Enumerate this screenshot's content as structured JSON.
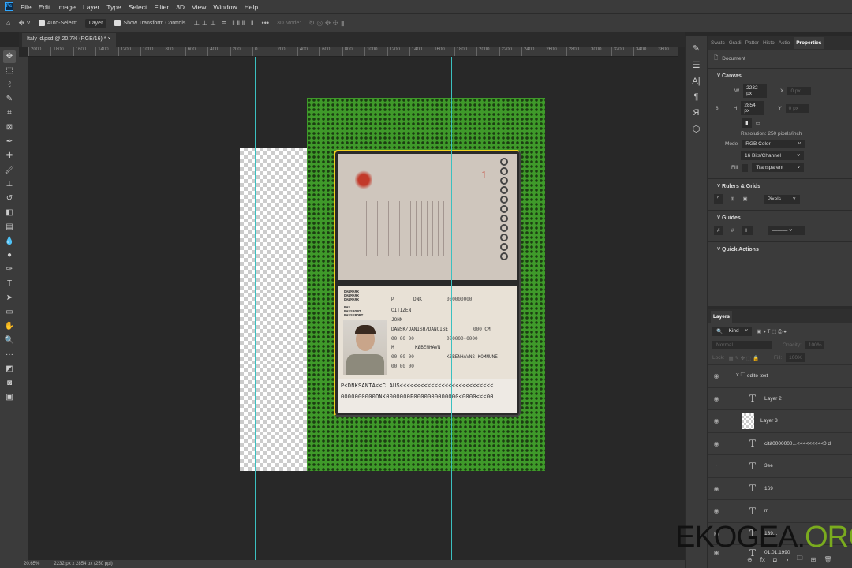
{
  "menu": [
    "File",
    "Edit",
    "Image",
    "Layer",
    "Type",
    "Select",
    "Filter",
    "3D",
    "View",
    "Window",
    "Help"
  ],
  "options": {
    "auto_select": "Auto-Select:",
    "auto_select_target": "Layer",
    "show_transform": "Show Transform Controls",
    "mode_3d": "3D Mode:"
  },
  "document_tab": "Italy id.psd @ 20.7% (RGB/16) *",
  "ruler_labels": [
    "2000",
    "1800",
    "1600",
    "1400",
    "1200",
    "1000",
    "800",
    "600",
    "400",
    "200",
    "0",
    "200",
    "400",
    "600",
    "800",
    "1000",
    "1200",
    "1400",
    "1600",
    "1800",
    "2000",
    "2200",
    "2400",
    "2600",
    "2800",
    "3000",
    "3200",
    "3400",
    "3600"
  ],
  "status": {
    "zoom": "20.65%",
    "doc_info": "2232 px x 2854 px (250 ppi)"
  },
  "passport": {
    "labels1": [
      "DANMARK",
      "DANMARK",
      "DANMARK"
    ],
    "labels2": [
      "PAS",
      "PASSPORT",
      "PASSEPORT"
    ],
    "type": "P",
    "code": "DNK",
    "number": "000000000",
    "surname": "CITIZEN",
    "given": "JOHN",
    "nationality": "DANSK/DANISH/DANOISE",
    "height": "000 CM",
    "dob": "00 00 00",
    "personal_no": "000000-0000",
    "sex": "M",
    "pob": "KØBENHAVN",
    "issue": "00 00 00",
    "authority": "KØBENHAVNS KOMMUNE",
    "expiry": "00 00 00",
    "page_number": "1",
    "mrz1": "P<DNKSANTA<<CLAUS<<<<<<<<<<<<<<<<<<<<<<<<<<<",
    "mrz2": "0000000000DNK0000000F0000000000000<0000<<<00"
  },
  "properties": {
    "tabs": [
      "Swatc",
      "Gradi",
      "Patter",
      "Histo",
      "Actio",
      "Properties"
    ],
    "doc_label": "Document",
    "canvas_title": "Canvas",
    "w_label": "W",
    "w": "2232 px",
    "h_label": "H",
    "h": "2854 px",
    "x_label": "X",
    "y_label": "Y",
    "xy_placeholder": "0 px",
    "resolution": "Resolution: 250 pixels/inch",
    "mode_label": "Mode",
    "mode": "RGB Color",
    "depth": "16 Bits/Channel",
    "fill_label": "Fill",
    "fill": "Transparent",
    "rulers_title": "Rulers & Grids",
    "units": "Pixels",
    "guides_title": "Guides",
    "quick_actions": "Quick Actions"
  },
  "layers": {
    "tab": "Layers",
    "filter": "Kind",
    "blend": "Normal",
    "opacity_label": "Opacity:",
    "opacity": "100%",
    "lock_label": "Lock:",
    "fill_label": "Fill:",
    "fill": "100%",
    "items": [
      {
        "name": "edite text",
        "kind": "group"
      },
      {
        "name": "Layer 2",
        "kind": "text"
      },
      {
        "name": "Layer 3",
        "kind": "pixel"
      },
      {
        "name": "cità0000000...<<<<<<<<<0 d",
        "kind": "text"
      },
      {
        "name": "3ee",
        "kind": "text"
      },
      {
        "name": "169",
        "kind": "text"
      },
      {
        "name": "m",
        "kind": "text"
      },
      {
        "name": "139...",
        "kind": "text"
      },
      {
        "name": "01.01.1990",
        "kind": "text"
      }
    ]
  },
  "watermark": {
    "part1": "EKOGEA.",
    "part2": "ORG"
  }
}
